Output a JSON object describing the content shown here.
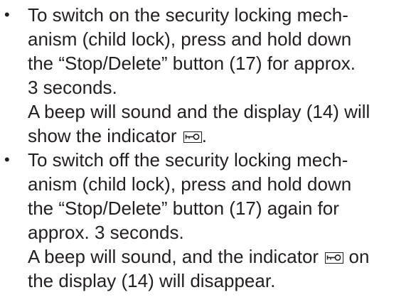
{
  "instructions": {
    "bullet_symbol": "•",
    "items": [
      {
        "lines": [
          "To switch on the security locking mech-",
          "anism (child lock), press and hold down",
          "the “Stop/Delete” button (17) for approx.",
          "3 seconds.",
          "A beep will sound and the display (14) will",
          "show the indicator",
          "."
        ]
      },
      {
        "lines": [
          "To switch off the security locking mech-",
          "anism (child lock), press and hold down",
          "the “Stop/Delete” button (17) again for",
          "approx. 3 seconds.",
          "A beep will sound, and the indicator",
          "on",
          "the display (14) will disappear."
        ]
      }
    ],
    "indicator_icon": "child-lock-key-icon",
    "text_color": "#231f20"
  }
}
